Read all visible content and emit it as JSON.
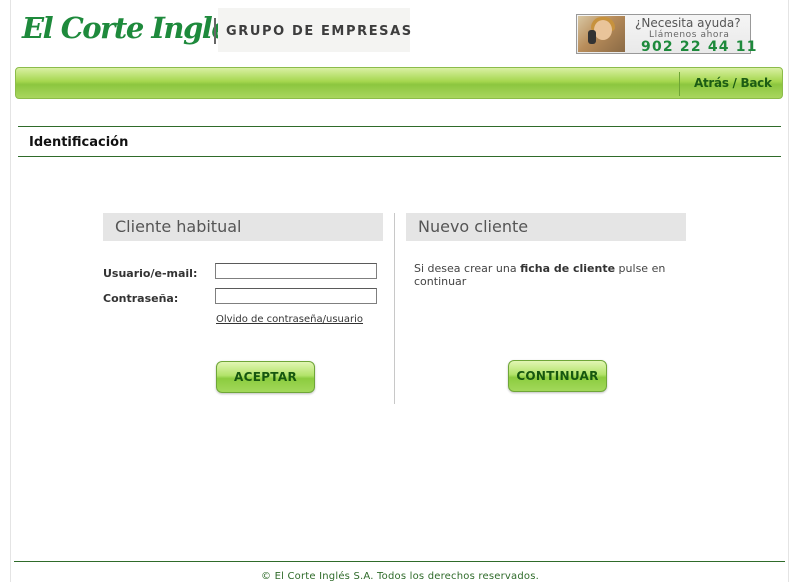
{
  "header": {
    "logo_text": "El Corte Inglés",
    "group_label": "GRUPO DE EMPRESAS",
    "help": {
      "title": "¿Necesita ayuda?",
      "subtitle": "Llámenos ahora",
      "phone": "902 22 44 11",
      "photo_icon": "support-agent-photo"
    }
  },
  "navbar": {
    "back_label": "Atrás / Back"
  },
  "page": {
    "section_title": "Identificación"
  },
  "returning_customer": {
    "title": "Cliente habitual",
    "username_label": "Usuario/e-mail:",
    "username_value": "",
    "password_label": "Contraseña:",
    "password_value": "",
    "forgot_link": "Olvido de contraseña/usuario",
    "submit_label": "ACEPTAR"
  },
  "new_customer": {
    "title": "Nuevo cliente",
    "text_before": "Si desea crear una ",
    "text_bold": "ficha de cliente",
    "text_after": " pulse en continuar",
    "continue_label": "CONTINUAR"
  },
  "footer": {
    "copyright": "© El Corte Inglés S.A. Todos los derechos reservados."
  },
  "colors": {
    "brand_green": "#1e8a3c",
    "nav_green": "#8cc63f",
    "rule_green": "#2f6b2a",
    "panel_header_bg": "#e5e5e5"
  }
}
